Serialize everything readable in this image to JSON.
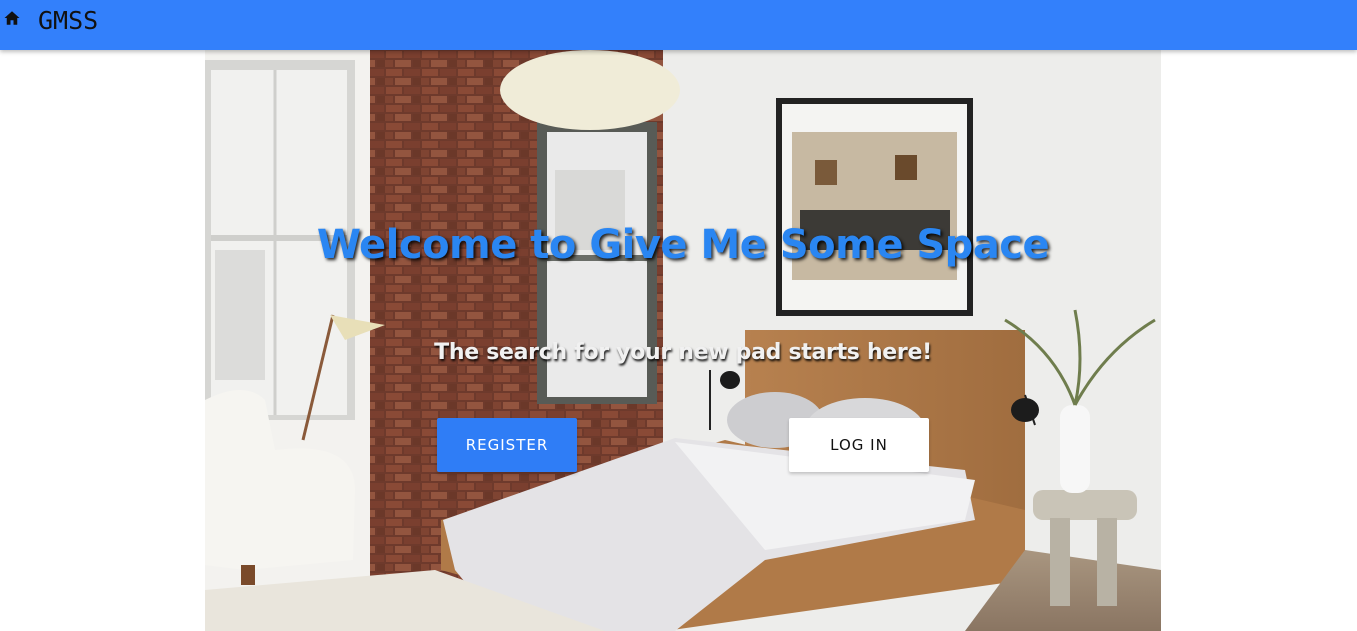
{
  "navbar": {
    "brand_icon": "home-icon",
    "brand_text": "GMSS",
    "bg_color": "#3380fb"
  },
  "hero": {
    "title": "Welcome to Give Me Some Space",
    "subtitle": "The search for your new pad starts here!",
    "title_color": "#2a86f2",
    "background_image": "bedroom-photo",
    "buttons": {
      "register_label": "REGISTER",
      "login_label": "LOG IN",
      "register_color": "#2f7df6",
      "login_color": "#ffffff"
    }
  }
}
